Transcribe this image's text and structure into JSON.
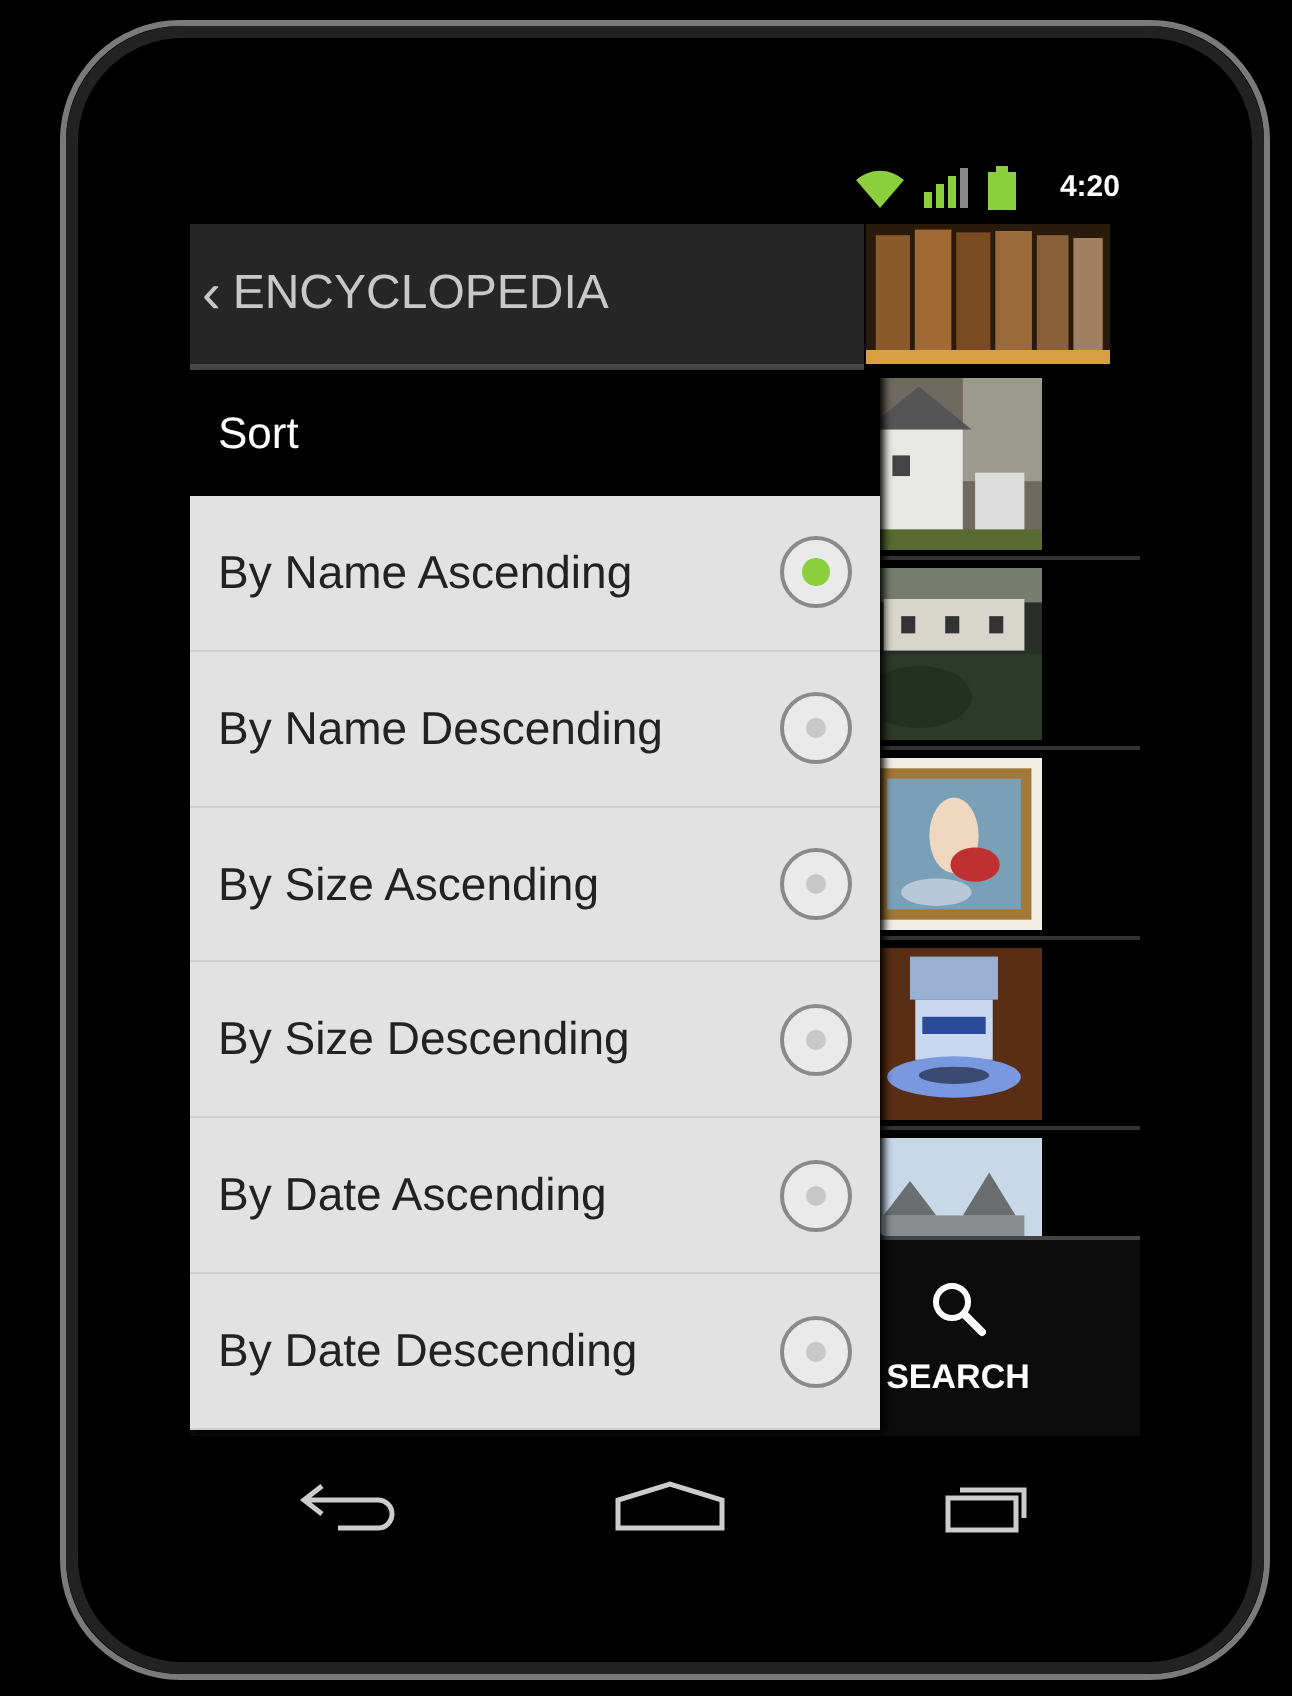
{
  "status_bar": {
    "time": "4:20"
  },
  "action_bar": {
    "back": "‹",
    "title": "ENCYCLOPEDIA"
  },
  "bottom_bar": {
    "actions": [
      {
        "label": "SEARCH"
      }
    ]
  },
  "dialog": {
    "title": "Sort",
    "options": [
      {
        "label": "By Name Ascending",
        "selected": true
      },
      {
        "label": "By Name Descending",
        "selected": false
      },
      {
        "label": "By Size Ascending",
        "selected": false
      },
      {
        "label": "By Size Descending",
        "selected": false
      },
      {
        "label": "By Date Ascending",
        "selected": false
      },
      {
        "label": "By Date Descending",
        "selected": false
      }
    ]
  }
}
